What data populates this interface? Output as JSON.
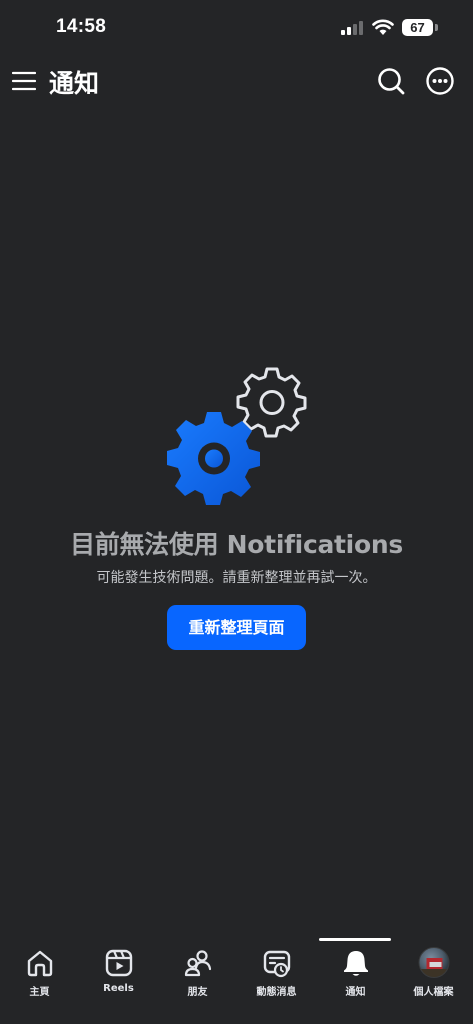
{
  "status_bar": {
    "time": "14:58",
    "battery": "67",
    "icons": [
      "signal-icon",
      "wifi-icon",
      "battery-icon"
    ]
  },
  "header": {
    "title": "通知",
    "icons": [
      "menu-icon",
      "search-icon",
      "more-icon"
    ]
  },
  "error_state": {
    "illustration": "gears-icon",
    "title": "目前無法使用 Notifications",
    "subtitle": "可能發生技術問題。請重新整理並再試一次。",
    "button_label": "重新整理頁面"
  },
  "bottom_nav": {
    "active": "notifications",
    "items": [
      {
        "id": "home",
        "label": "主頁",
        "icon": "home-icon"
      },
      {
        "id": "reels",
        "label": "Reels",
        "icon": "reels-icon"
      },
      {
        "id": "friends",
        "label": "朋友",
        "icon": "friends-icon"
      },
      {
        "id": "feeds",
        "label": "動態消息",
        "icon": "feeds-icon"
      },
      {
        "id": "notifications",
        "label": "通知",
        "icon": "bell-icon"
      },
      {
        "id": "profile",
        "label": "個人檔案",
        "icon": "avatar"
      }
    ]
  },
  "colors": {
    "background": "#242527",
    "accent": "#0866ff",
    "text": "#e4e6eb"
  }
}
